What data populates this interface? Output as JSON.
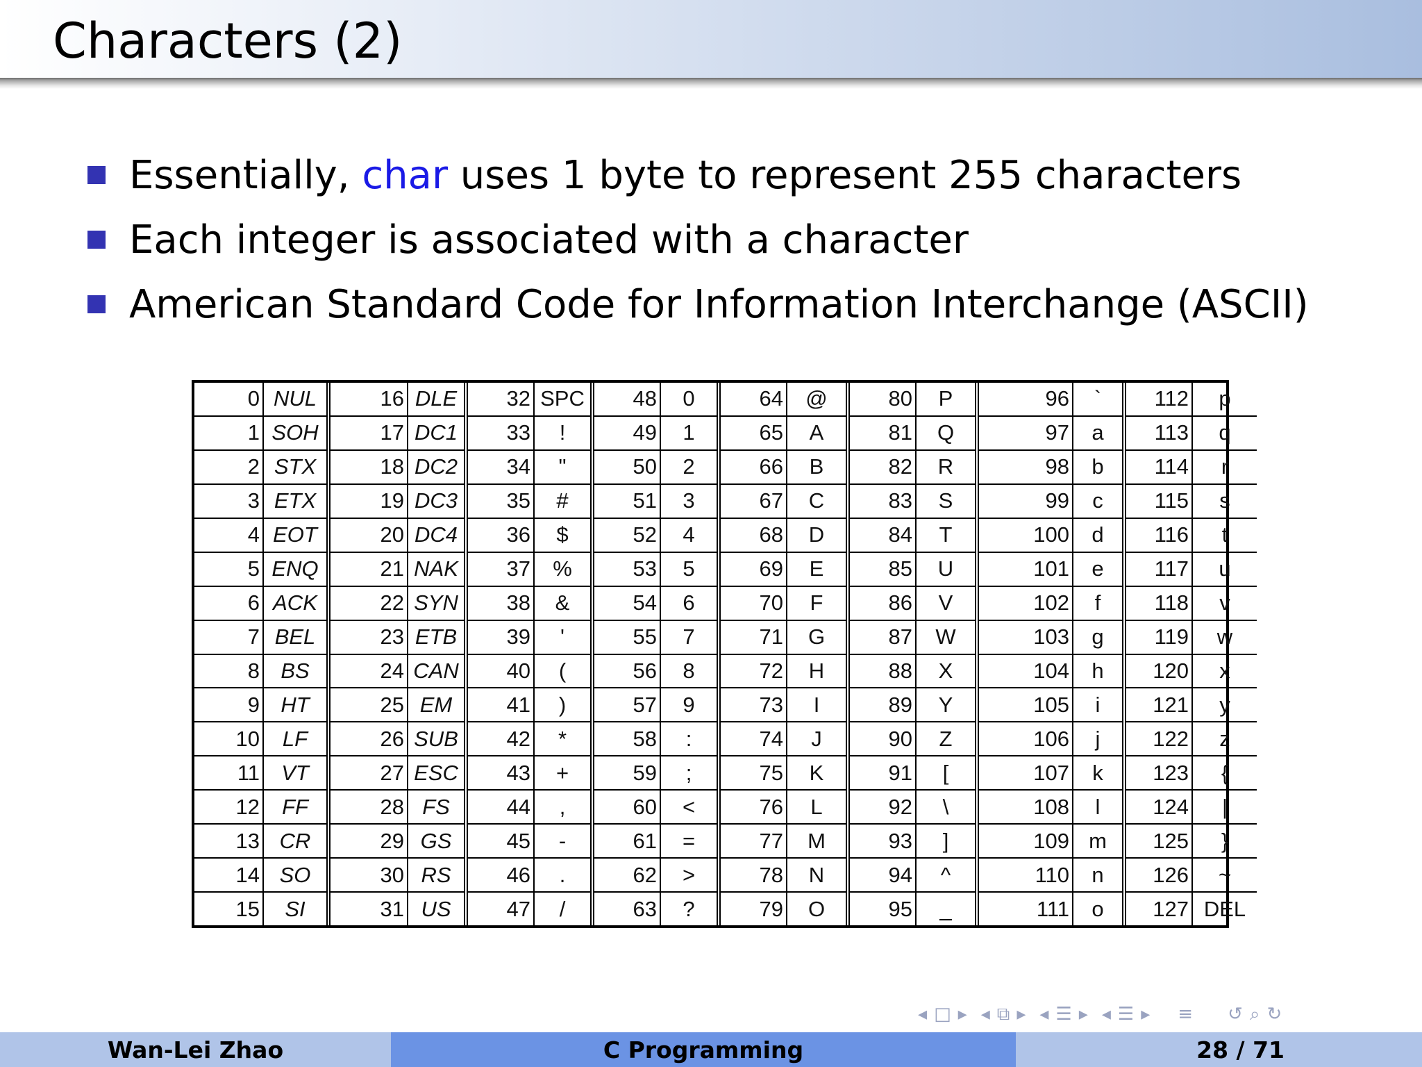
{
  "title": "Characters (2)",
  "bullets": [
    {
      "before": "Essentially, ",
      "keyword": "char",
      "after": " uses 1 byte to represent 255 characters"
    },
    {
      "text": "Each integer is associated with a character"
    },
    {
      "text": "American Standard Code for Information Interchange (ASCII)"
    }
  ],
  "ascii_table": [
    [
      [
        "0",
        "NUL"
      ],
      [
        "1",
        "SOH"
      ],
      [
        "2",
        "STX"
      ],
      [
        "3",
        "ETX"
      ],
      [
        "4",
        "EOT"
      ],
      [
        "5",
        "ENQ"
      ],
      [
        "6",
        "ACK"
      ],
      [
        "7",
        "BEL"
      ],
      [
        "8",
        "BS"
      ],
      [
        "9",
        "HT"
      ],
      [
        "10",
        "LF"
      ],
      [
        "11",
        "VT"
      ],
      [
        "12",
        "FF"
      ],
      [
        "13",
        "CR"
      ],
      [
        "14",
        "SO"
      ],
      [
        "15",
        "SI"
      ]
    ],
    [
      [
        "16",
        "DLE"
      ],
      [
        "17",
        "DC1"
      ],
      [
        "18",
        "DC2"
      ],
      [
        "19",
        "DC3"
      ],
      [
        "20",
        "DC4"
      ],
      [
        "21",
        "NAK"
      ],
      [
        "22",
        "SYN"
      ],
      [
        "23",
        "ETB"
      ],
      [
        "24",
        "CAN"
      ],
      [
        "25",
        "EM"
      ],
      [
        "26",
        "SUB"
      ],
      [
        "27",
        "ESC"
      ],
      [
        "28",
        "FS"
      ],
      [
        "29",
        "GS"
      ],
      [
        "30",
        "RS"
      ],
      [
        "31",
        "US"
      ]
    ],
    [
      [
        "32",
        "SPC"
      ],
      [
        "33",
        "!"
      ],
      [
        "34",
        "\""
      ],
      [
        "35",
        "#"
      ],
      [
        "36",
        "$"
      ],
      [
        "37",
        "%"
      ],
      [
        "38",
        "&"
      ],
      [
        "39",
        "'"
      ],
      [
        "40",
        "("
      ],
      [
        "41",
        ")"
      ],
      [
        "42",
        "*"
      ],
      [
        "43",
        "+"
      ],
      [
        "44",
        ","
      ],
      [
        "45",
        "-"
      ],
      [
        "46",
        "."
      ],
      [
        "47",
        "/"
      ]
    ],
    [
      [
        "48",
        "0"
      ],
      [
        "49",
        "1"
      ],
      [
        "50",
        "2"
      ],
      [
        "51",
        "3"
      ],
      [
        "52",
        "4"
      ],
      [
        "53",
        "5"
      ],
      [
        "54",
        "6"
      ],
      [
        "55",
        "7"
      ],
      [
        "56",
        "8"
      ],
      [
        "57",
        "9"
      ],
      [
        "58",
        ":"
      ],
      [
        "59",
        ";"
      ],
      [
        "60",
        "<"
      ],
      [
        "61",
        "="
      ],
      [
        "62",
        ">"
      ],
      [
        "63",
        "?"
      ]
    ],
    [
      [
        "64",
        "@"
      ],
      [
        "65",
        "A"
      ],
      [
        "66",
        "B"
      ],
      [
        "67",
        "C"
      ],
      [
        "68",
        "D"
      ],
      [
        "69",
        "E"
      ],
      [
        "70",
        "F"
      ],
      [
        "71",
        "G"
      ],
      [
        "72",
        "H"
      ],
      [
        "73",
        "I"
      ],
      [
        "74",
        "J"
      ],
      [
        "75",
        "K"
      ],
      [
        "76",
        "L"
      ],
      [
        "77",
        "M"
      ],
      [
        "78",
        "N"
      ],
      [
        "79",
        "O"
      ]
    ],
    [
      [
        "80",
        "P"
      ],
      [
        "81",
        "Q"
      ],
      [
        "82",
        "R"
      ],
      [
        "83",
        "S"
      ],
      [
        "84",
        "T"
      ],
      [
        "85",
        "U"
      ],
      [
        "86",
        "V"
      ],
      [
        "87",
        "W"
      ],
      [
        "88",
        "X"
      ],
      [
        "89",
        "Y"
      ],
      [
        "90",
        "Z"
      ],
      [
        "91",
        "["
      ],
      [
        "92",
        "\\"
      ],
      [
        "93",
        "]"
      ],
      [
        "94",
        "^"
      ],
      [
        "95",
        "_"
      ]
    ],
    [
      [
        "96",
        "`"
      ],
      [
        "97",
        "a"
      ],
      [
        "98",
        "b"
      ],
      [
        "99",
        "c"
      ],
      [
        "100",
        "d"
      ],
      [
        "101",
        "e"
      ],
      [
        "102",
        "f"
      ],
      [
        "103",
        "g"
      ],
      [
        "104",
        "h"
      ],
      [
        "105",
        "i"
      ],
      [
        "106",
        "j"
      ],
      [
        "107",
        "k"
      ],
      [
        "108",
        "l"
      ],
      [
        "109",
        "m"
      ],
      [
        "110",
        "n"
      ],
      [
        "111",
        "o"
      ]
    ],
    [
      [
        "112",
        "p"
      ],
      [
        "113",
        "q"
      ],
      [
        "114",
        "r"
      ],
      [
        "115",
        "s"
      ],
      [
        "116",
        "t"
      ],
      [
        "117",
        "u"
      ],
      [
        "118",
        "v"
      ],
      [
        "119",
        "w"
      ],
      [
        "120",
        "x"
      ],
      [
        "121",
        "y"
      ],
      [
        "122",
        "z"
      ],
      [
        "123",
        "{"
      ],
      [
        "124",
        "|"
      ],
      [
        "125",
        "}"
      ],
      [
        "126",
        "~"
      ],
      [
        "127",
        "DEL"
      ]
    ]
  ],
  "nav_icons": [
    "prev-arrow-icon",
    "frame-icon",
    "next-arrow-icon",
    "prev-arrow-icon",
    "subsection-icon",
    "next-arrow-icon",
    "prev-arrow-icon",
    "section-icon",
    "next-arrow-icon",
    "prev-arrow-icon",
    "outline-icon",
    "next-arrow-icon",
    "align-icon",
    "undo-icon",
    "zoom-icon"
  ],
  "footer": {
    "author": "Wan-Lei Zhao",
    "course": "C Programming",
    "page": "28 / 71"
  },
  "colors": {
    "bullet": "#3333b2",
    "keyword": "#1a1ae6",
    "footer_light": "#b0c4e8",
    "footer_dark": "#6b93e4"
  }
}
